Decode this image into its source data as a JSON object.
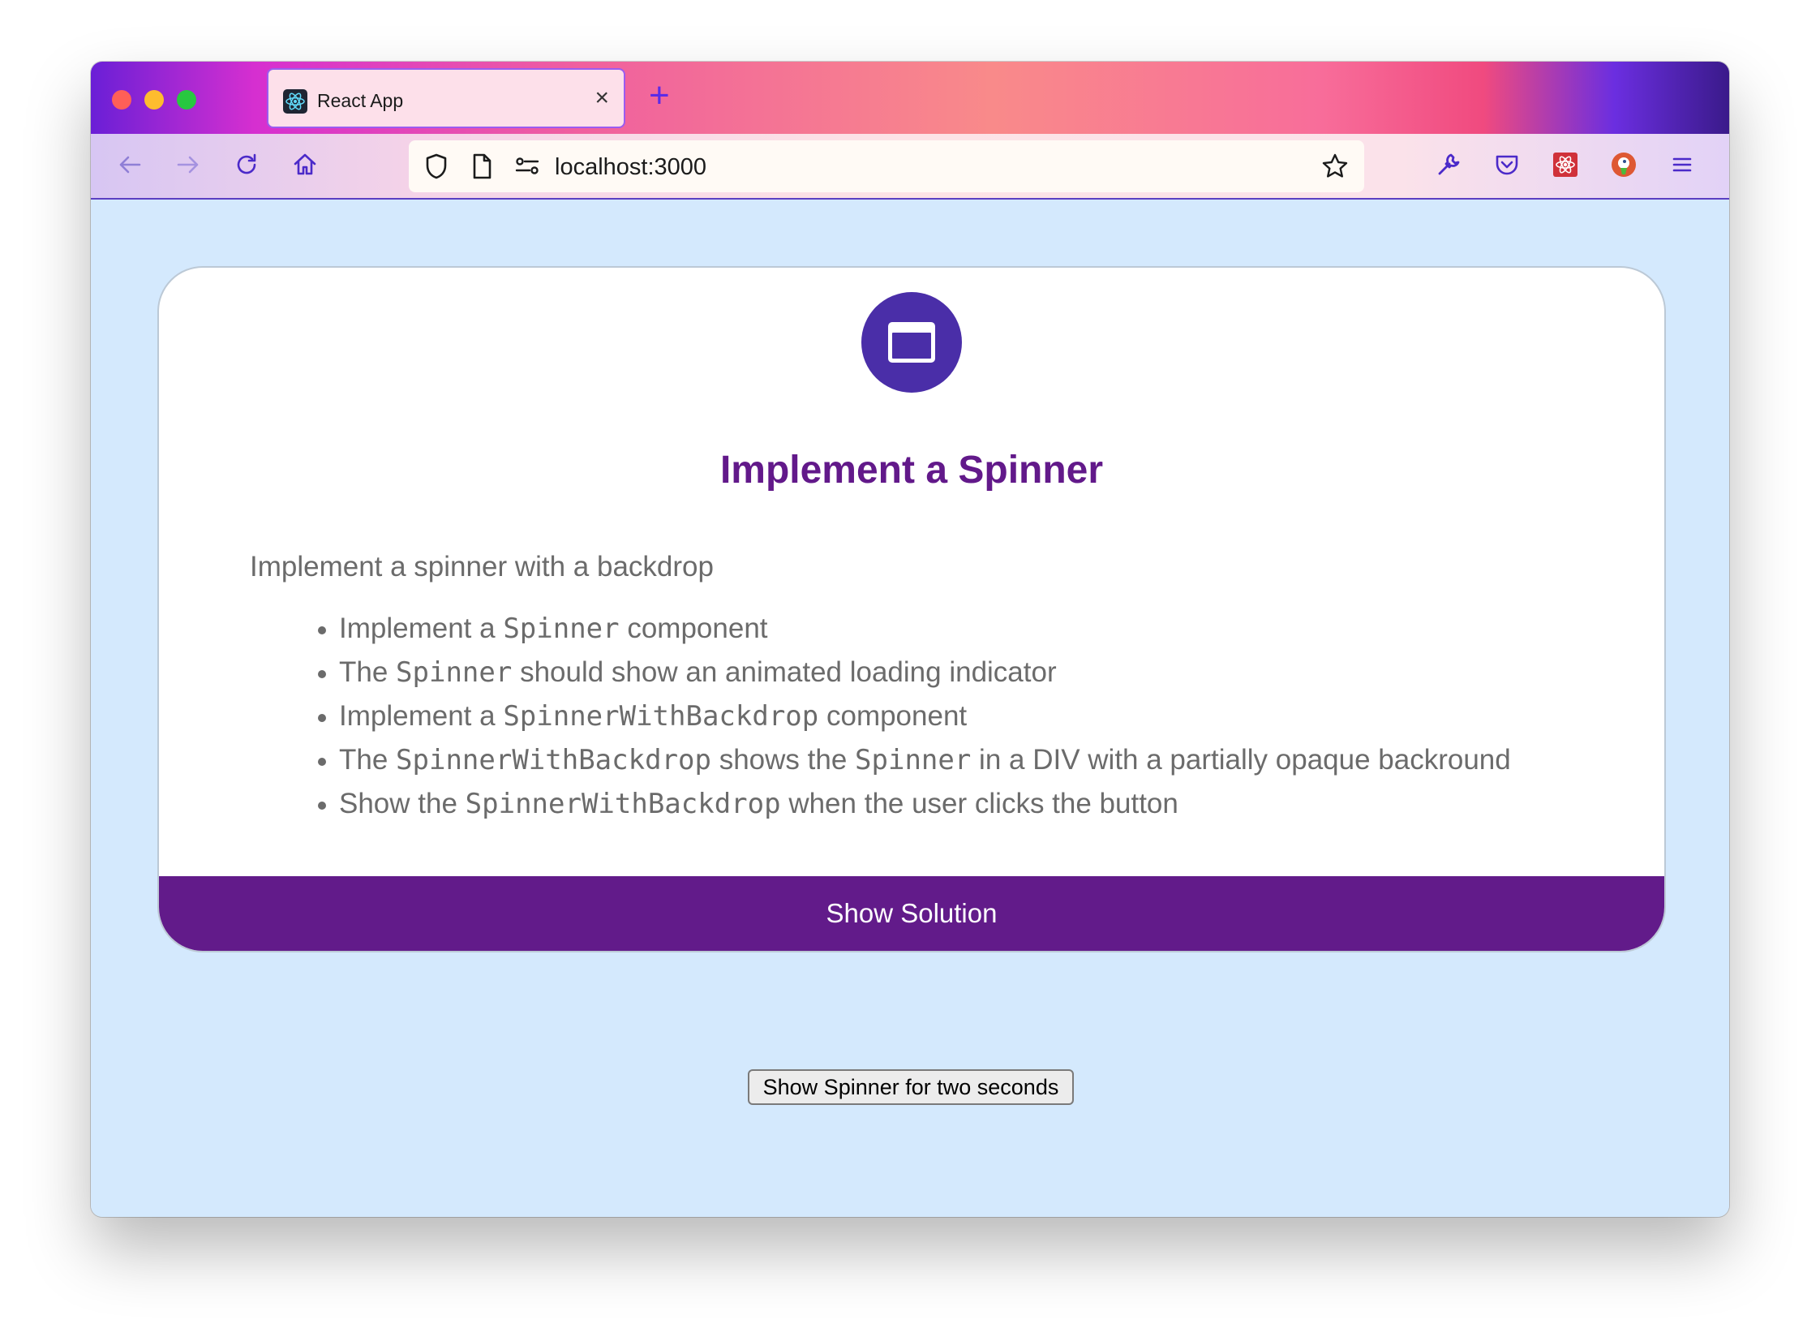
{
  "browser": {
    "tab_title": "React App",
    "url": "localhost:3000"
  },
  "card": {
    "title": "Implement a Spinner",
    "description": "Implement a spinner with a backdrop",
    "items": [
      [
        {
          "t": "Implement a "
        },
        {
          "c": "Spinner"
        },
        {
          "t": " component"
        }
      ],
      [
        {
          "t": "The "
        },
        {
          "c": "Spinner"
        },
        {
          "t": " should show an animated loading indicator"
        }
      ],
      [
        {
          "t": "Implement a "
        },
        {
          "c": "SpinnerWithBackdrop"
        },
        {
          "t": " component"
        }
      ],
      [
        {
          "t": "The "
        },
        {
          "c": "SpinnerWithBackdrop"
        },
        {
          "t": " shows the "
        },
        {
          "c": "Spinner"
        },
        {
          "t": " in a DIV with a partially opaque backround"
        }
      ],
      [
        {
          "t": "Show the "
        },
        {
          "c": "SpinnerWithBackdrop"
        },
        {
          "t": " when the user clicks the button"
        }
      ]
    ],
    "solution_label": "Show Solution"
  },
  "spinner_button_label": "Show Spinner for two seconds",
  "colors": {
    "accent": "#621b8a",
    "icon_bg": "#4a2ea8",
    "page_bg": "#d4e9fd"
  }
}
